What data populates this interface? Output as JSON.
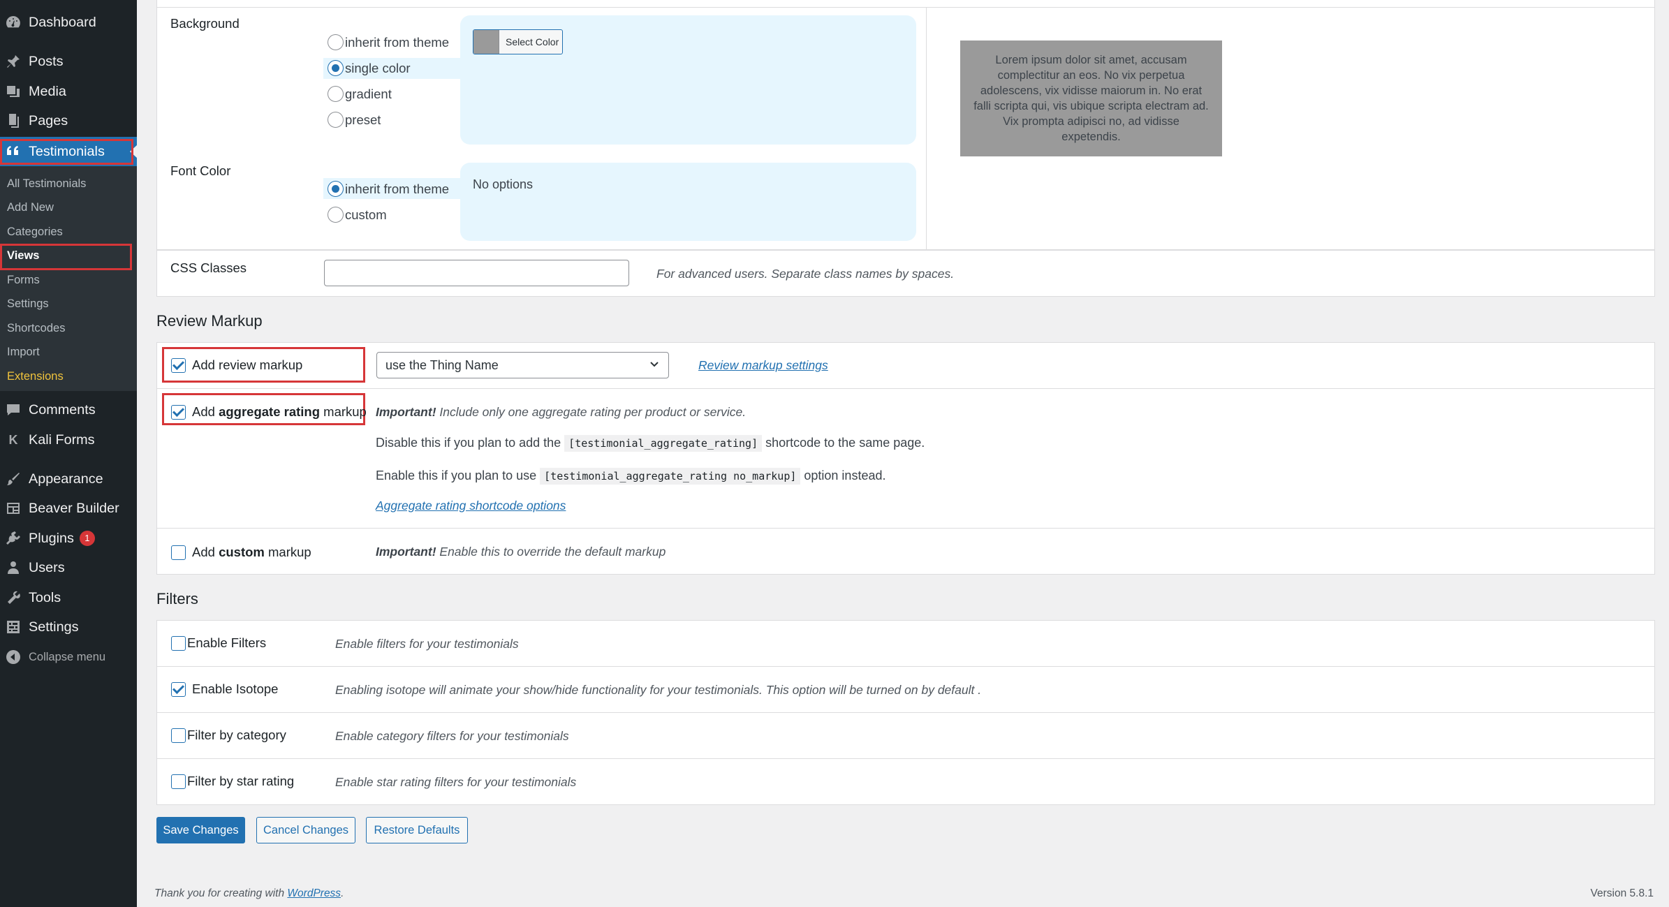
{
  "sidebar": {
    "items": [
      {
        "label": "Dashboard",
        "icon": "dashboard-icon"
      },
      {
        "label": "Posts",
        "icon": "pin-icon"
      },
      {
        "label": "Media",
        "icon": "media-icon"
      },
      {
        "label": "Pages",
        "icon": "pages-icon"
      },
      {
        "label": "Testimonials",
        "icon": "quote-icon"
      },
      {
        "label": "Comments",
        "icon": "comment-icon"
      },
      {
        "label": "Kali Forms",
        "icon": "kali-icon"
      },
      {
        "label": "Appearance",
        "icon": "brush-icon"
      },
      {
        "label": "Beaver Builder",
        "icon": "builder-icon"
      },
      {
        "label": "Plugins",
        "icon": "plugin-icon",
        "badge": "1"
      },
      {
        "label": "Users",
        "icon": "user-icon"
      },
      {
        "label": "Tools",
        "icon": "wrench-icon"
      },
      {
        "label": "Settings",
        "icon": "settings-icon"
      }
    ],
    "submenu": [
      "All Testimonials",
      "Add New",
      "Categories",
      "Views",
      "Forms",
      "Settings",
      "Shortcodes",
      "Import",
      "Extensions"
    ],
    "collapse": "Collapse menu",
    "plugins_badge": "1",
    "kali_letter": "K"
  },
  "background": {
    "label": "Background",
    "options": [
      "inherit from theme",
      "single color",
      "gradient",
      "preset"
    ],
    "selected": "single color",
    "select_color": "Select Color",
    "swatch_color": "#9a9a9a"
  },
  "font_color": {
    "label": "Font Color",
    "options": [
      "inherit from theme",
      "custom"
    ],
    "selected": "inherit from theme",
    "no_options": "No options"
  },
  "preview_text": "Lorem ipsum dolor sit amet, accusam complectitur an eos. No vix perpetua adolescens, vix vidisse maiorum in. No erat falli scripta qui, vis ubique scripta electram ad. Vix prompta adipisci no, ad vidisse expetendis.",
  "css_classes": {
    "label": "CSS Classes",
    "value": "",
    "help": "For advanced users. Separate class names by spaces."
  },
  "review_markup": {
    "heading": "Review Markup",
    "add_review": {
      "label": "Add review markup",
      "checked": true
    },
    "thing_name_select": "use the Thing Name",
    "settings_link": "Review markup settings",
    "aggregate": {
      "label_pre": "Add ",
      "label_bold": "aggregate rating",
      "label_post": " markup",
      "checked": true
    },
    "important": "Important!",
    "aggregate_important_text": " Include only one aggregate rating per product or service.",
    "disable_pre": "Disable this if you plan to add the ",
    "disable_code": "[testimonial_aggregate_rating]",
    "disable_post": " shortcode to the same page.",
    "enable_pre": "Enable this if you plan to use ",
    "enable_code": "[testimonial_aggregate_rating no_markup]",
    "enable_post": " option instead.",
    "aggregate_link": "Aggregate rating shortcode options",
    "custom": {
      "label_pre": "Add ",
      "label_bold": "custom",
      "label_post": " markup",
      "checked": false
    },
    "custom_important_text": " Enable this to override the default markup"
  },
  "filters": {
    "heading": "Filters",
    "rows": [
      {
        "label": "Enable Filters",
        "checked": false,
        "desc": "Enable filters for your testimonials"
      },
      {
        "label": "Enable Isotope",
        "checked": true,
        "desc": "Enabling isotope will animate your show/hide functionality for your testimonials. This option will be turned on by default ."
      },
      {
        "label": "Filter by category",
        "checked": false,
        "desc": "Enable category filters for your testimonials"
      },
      {
        "label": "Filter by star rating",
        "checked": false,
        "desc": "Enable star rating filters for your testimonials"
      }
    ]
  },
  "buttons": {
    "save": "Save Changes",
    "cancel": "Cancel Changes",
    "restore": "Restore Defaults"
  },
  "footer": {
    "thanks_pre": "Thank you for creating with ",
    "wordpress": "WordPress",
    "thanks_post": ".",
    "version": "Version 5.8.1"
  },
  "colors": {
    "accent": "#2271b1",
    "highlight": "#d63638",
    "sidebar": "#1d2327"
  }
}
